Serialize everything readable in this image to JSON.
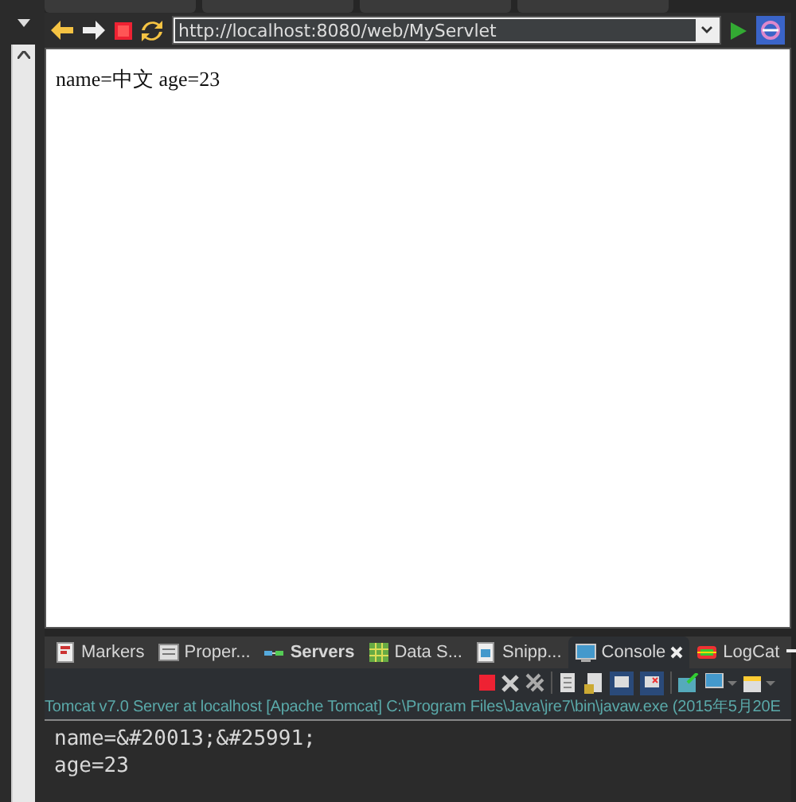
{
  "browser": {
    "url": "http://localhost:8080/web/MyServlet",
    "content": "name=中文 age=23"
  },
  "view_tabs": [
    {
      "label": "Markers",
      "kind": "markers",
      "selected": false,
      "bold": false
    },
    {
      "label": "Proper...",
      "kind": "properties",
      "selected": false,
      "bold": false
    },
    {
      "label": "Servers",
      "kind": "servers",
      "selected": false,
      "bold": true
    },
    {
      "label": "Data S...",
      "kind": "data",
      "selected": false,
      "bold": false
    },
    {
      "label": "Snipp...",
      "kind": "snippets",
      "selected": false,
      "bold": false
    },
    {
      "label": "Console",
      "kind": "console",
      "selected": true,
      "bold": false
    },
    {
      "label": "LogCat",
      "kind": "logcat",
      "selected": false,
      "bold": false
    }
  ],
  "console": {
    "title": "Tomcat v7.0 Server at localhost [Apache Tomcat] C:\\Program Files\\Java\\jre7\\bin\\javaw.exe (2015年5月20E",
    "lines": [
      "name=&#20013;&#25991;",
      "age=23"
    ]
  }
}
